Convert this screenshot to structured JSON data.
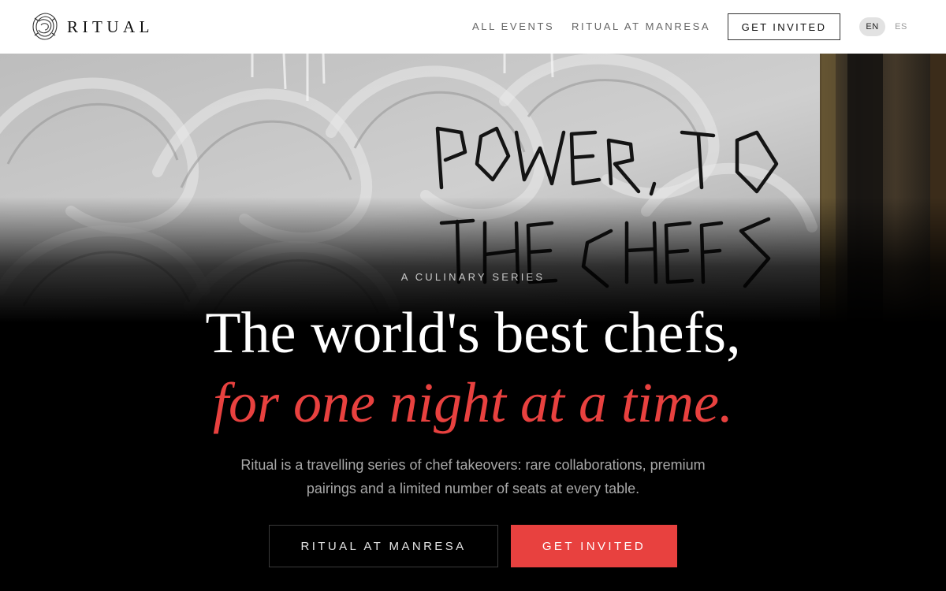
{
  "brand": {
    "name": "RITUAL",
    "logo_icon": "ritual-ornament-icon"
  },
  "nav": {
    "all_events": "ALL EVENTS",
    "ritual_at_manresa": "RITUAL AT MANRESA",
    "get_invited": "GET INVITED",
    "languages": [
      {
        "code": "EN",
        "active": true
      },
      {
        "code": "ES",
        "active": false
      }
    ]
  },
  "hero": {
    "image_text": [
      "POWER TO",
      "THE CHEFS"
    ],
    "eyebrow": "A CULINARY SERIES",
    "headline": "The world's best chefs,",
    "subheadline": "for one night at a time.",
    "intro": "Ritual is a travelling series of chef takeovers: rare collaborations, premium pairings and a limited number of seats at every table.",
    "buttons": {
      "secondary": "RITUAL AT MANRESA",
      "primary": "GET INVITED"
    }
  },
  "colors": {
    "accent": "#e8413f",
    "background": "#000000",
    "header_bg": "#ffffff"
  }
}
